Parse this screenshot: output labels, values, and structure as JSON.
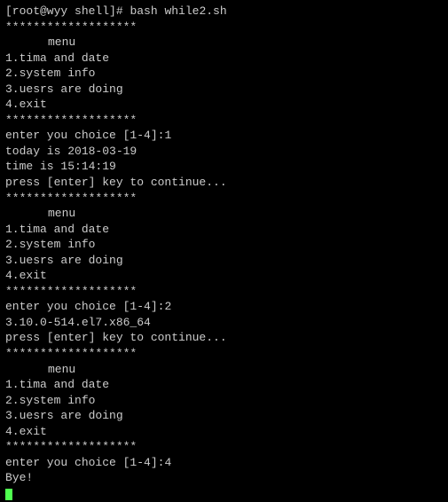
{
  "prompt": "[root@wyy shell]# ",
  "command": "bash while2.sh",
  "separator": "*******************",
  "menu": {
    "title": "menu",
    "item1": "1.tima and date",
    "item2": "2.system info",
    "item3": "3.uesrs are doing",
    "item4": "4.exit"
  },
  "promptChoice": "enter you choice [1-4]:",
  "run1": {
    "input": "1",
    "line1": "today is 2018-03-19",
    "line2": "time is 15:14:19",
    "continue": "press [enter] key to continue..."
  },
  "run2": {
    "input": "2",
    "line1": "3.10.0-514.el7.x86_64",
    "continue": "press [enter] key to continue..."
  },
  "run3": {
    "input": "4",
    "bye": "Bye!"
  }
}
